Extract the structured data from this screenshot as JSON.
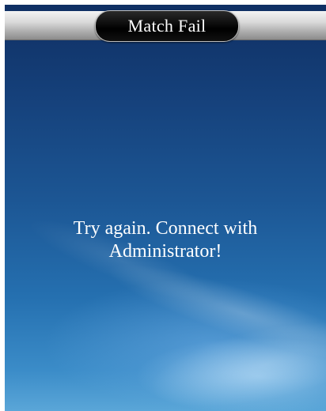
{
  "dialog": {
    "title": "Match Fail",
    "message_line_1": "Try again. Connect with",
    "message_line_2": "Administrator!"
  },
  "colors": {
    "background_top": "#0f2f63",
    "background_bottom": "#5aa6d8",
    "title_pill": "#000000",
    "text": "#ffffff"
  }
}
